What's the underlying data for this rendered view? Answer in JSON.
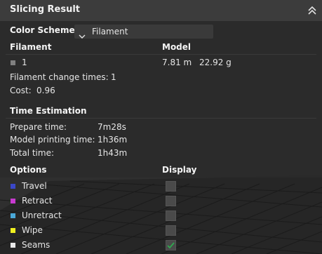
{
  "header": {
    "title": "Slicing Result"
  },
  "color_scheme": {
    "label": "Color Scheme",
    "selected": "Filament"
  },
  "filament_table": {
    "col_filament": "Filament",
    "col_model": "Model",
    "row": {
      "id": "1",
      "length": "7.81 m",
      "weight": "22.92 g",
      "swatch_color": "#808080"
    },
    "change_times_label": "Filament change times:",
    "change_times_value": "1",
    "cost_label": "Cost:",
    "cost_value": "0.96"
  },
  "time_estimation": {
    "title": "Time Estimation",
    "prepare_label": "Prepare time:",
    "prepare_value": "7m28s",
    "model_printing_label": "Model printing time:",
    "model_printing_value": "1h36m",
    "total_label": "Total time:",
    "total_value": "1h43m"
  },
  "options": {
    "col_options": "Options",
    "col_display": "Display",
    "items": [
      {
        "label": "Travel",
        "color": "#3a47c8",
        "checked": false
      },
      {
        "label": "Retract",
        "color": "#c83ad0",
        "checked": false
      },
      {
        "label": "Unretract",
        "color": "#4aa8d8",
        "checked": false
      },
      {
        "label": "Wipe",
        "color": "#f0f020",
        "checked": false
      },
      {
        "label": "Seams",
        "color": "#e8e8e8",
        "checked": true
      }
    ]
  },
  "icons": {
    "collapse": "double-chevron-up-icon",
    "dropdown": "chevron-down-icon",
    "check": "checkmark-icon"
  },
  "colors": {
    "check": "#2fa84f",
    "panel_bg": "#2b2b2b",
    "header_bg": "#3c3c3c"
  }
}
